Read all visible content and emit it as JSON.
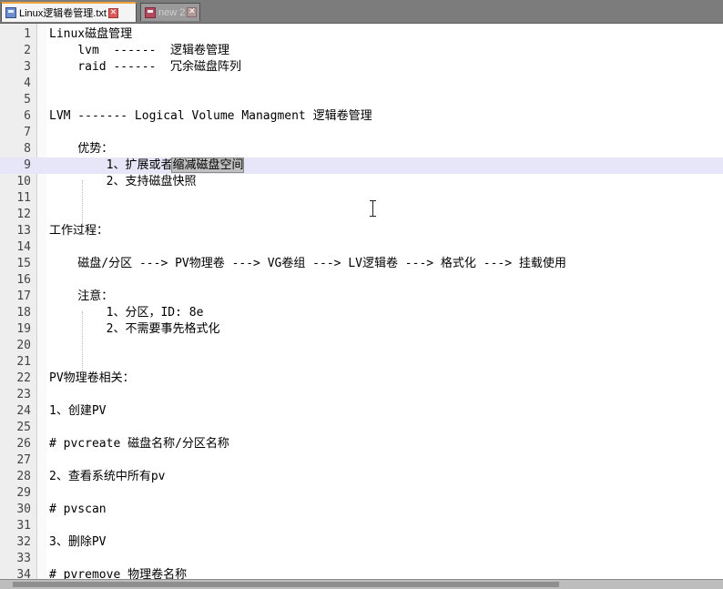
{
  "tabs": [
    {
      "label": "Linux逻辑卷管理.txt",
      "active": true,
      "icon": "text-file-icon"
    },
    {
      "label": "new 2",
      "active": false,
      "icon": "text-file-icon"
    }
  ],
  "close_glyph": "✕",
  "current_line": 9,
  "lines": [
    {
      "n": "1",
      "text": "Linux磁盘管理"
    },
    {
      "n": "2",
      "text": "    lvm  ------  逻辑卷管理"
    },
    {
      "n": "3",
      "text": "    raid ------  冗余磁盘阵列"
    },
    {
      "n": "4",
      "text": ""
    },
    {
      "n": "5",
      "text": ""
    },
    {
      "n": "6",
      "text": "LVM ------- Logical Volume Managment 逻辑卷管理"
    },
    {
      "n": "7",
      "text": ""
    },
    {
      "n": "8",
      "text": "    优势："
    },
    {
      "n": "9",
      "text_pre": "        1、扩展或者",
      "text_sel": "缩减磁盘空间"
    },
    {
      "n": "10",
      "text": "        2、支持磁盘快照"
    },
    {
      "n": "11",
      "text": ""
    },
    {
      "n": "12",
      "text": ""
    },
    {
      "n": "13",
      "text": "工作过程："
    },
    {
      "n": "14",
      "text": ""
    },
    {
      "n": "15",
      "text": "    磁盘/分区 ---> PV物理卷 ---> VG卷组 ---> LV逻辑卷 ---> 格式化 ---> 挂载使用"
    },
    {
      "n": "16",
      "text": ""
    },
    {
      "n": "17",
      "text": "    注意："
    },
    {
      "n": "18",
      "text": "        1、分区，ID: 8e"
    },
    {
      "n": "19",
      "text": "        2、不需要事先格式化"
    },
    {
      "n": "20",
      "text": ""
    },
    {
      "n": "21",
      "text": ""
    },
    {
      "n": "22",
      "text": "PV物理卷相关："
    },
    {
      "n": "23",
      "text": ""
    },
    {
      "n": "24",
      "text": "1、创建PV"
    },
    {
      "n": "25",
      "text": ""
    },
    {
      "n": "26",
      "text": "# pvcreate 磁盘名称/分区名称"
    },
    {
      "n": "27",
      "text": ""
    },
    {
      "n": "28",
      "text": "2、查看系统中所有pv"
    },
    {
      "n": "29",
      "text": ""
    },
    {
      "n": "30",
      "text": "# pvscan"
    },
    {
      "n": "31",
      "text": ""
    },
    {
      "n": "32",
      "text": "3、删除PV"
    },
    {
      "n": "33",
      "text": ""
    },
    {
      "n": "34",
      "text": "# pvremove 物理卷名称"
    }
  ]
}
